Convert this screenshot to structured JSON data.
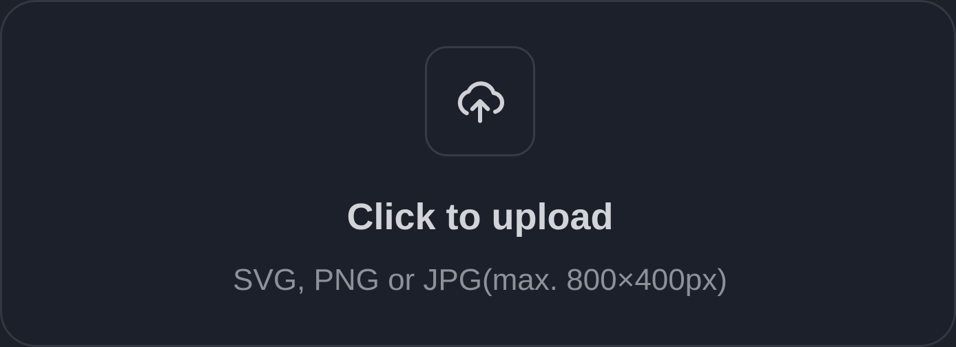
{
  "upload": {
    "icon": "cloud-upload-icon",
    "title": "Click to upload",
    "hint": "SVG, PNG or JPG(max. 800×400px)"
  },
  "colors": {
    "background": "#1c202a",
    "border": "#323742",
    "icon": "#cfd1d6",
    "title": "#d2d4d9",
    "hint": "#8d919a"
  }
}
